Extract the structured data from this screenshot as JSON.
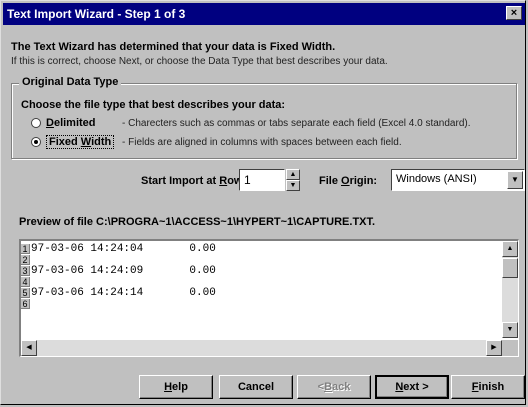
{
  "window": {
    "title": "Text Import Wizard - Step 1 of 3",
    "close_label": "×"
  },
  "intro": {
    "line1": "The Text Wizard has determined that your data is Fixed Width.",
    "line2": "If this is correct, choose Next, or choose the Data Type that best describes your data."
  },
  "original_data_type": {
    "title": "Original Data Type",
    "choose_label": "Choose the file type that best describes your data:",
    "options": [
      {
        "label_pre": "",
        "label_u": "D",
        "label_post": "elimited",
        "description": "- Charecters such as commas or tabs separate each field (Excel 4.0 standard).",
        "selected": false
      },
      {
        "label_pre": "Fixed ",
        "label_u": "W",
        "label_post": "idth",
        "description": "- Fields are aligned in columns with spaces between each field.",
        "selected": true
      }
    ]
  },
  "start_import": {
    "label_pre": "Start Import at ",
    "label_u": "R",
    "label_post": "ow:",
    "value": "1"
  },
  "file_origin": {
    "label_pre": "File ",
    "label_u": "O",
    "label_post": "rigin:",
    "value": "Windows (ANSI)"
  },
  "preview": {
    "label": "Preview of file C:\\PROGRA~1\\ACCESS~1\\HYPERT~1\\CAPTURE.TXT.",
    "rows": [
      {
        "num": "1",
        "text": "97-03-06 14:24:04       0.00"
      },
      {
        "num": "2",
        "text": ""
      },
      {
        "num": "3",
        "text": "97-03-06 14:24:09       0.00"
      },
      {
        "num": "4",
        "text": ""
      },
      {
        "num": "5",
        "text": "97-03-06 14:24:14       0.00"
      },
      {
        "num": "6",
        "text": ""
      }
    ]
  },
  "buttons": {
    "help": {
      "u": "H",
      "rest": "elp"
    },
    "cancel": {
      "label": "Cancel"
    },
    "back": {
      "pre": "< ",
      "u": "B",
      "rest": "ack"
    },
    "next": {
      "u": "N",
      "rest": "ext >"
    },
    "finish": {
      "u": "F",
      "rest": "inish"
    }
  },
  "icons": {
    "spin_up": "▲",
    "spin_down": "▼",
    "dropdown": "▼",
    "scroll_up": "▲",
    "scroll_down": "▼",
    "scroll_left": "◀",
    "scroll_right": "▶"
  }
}
